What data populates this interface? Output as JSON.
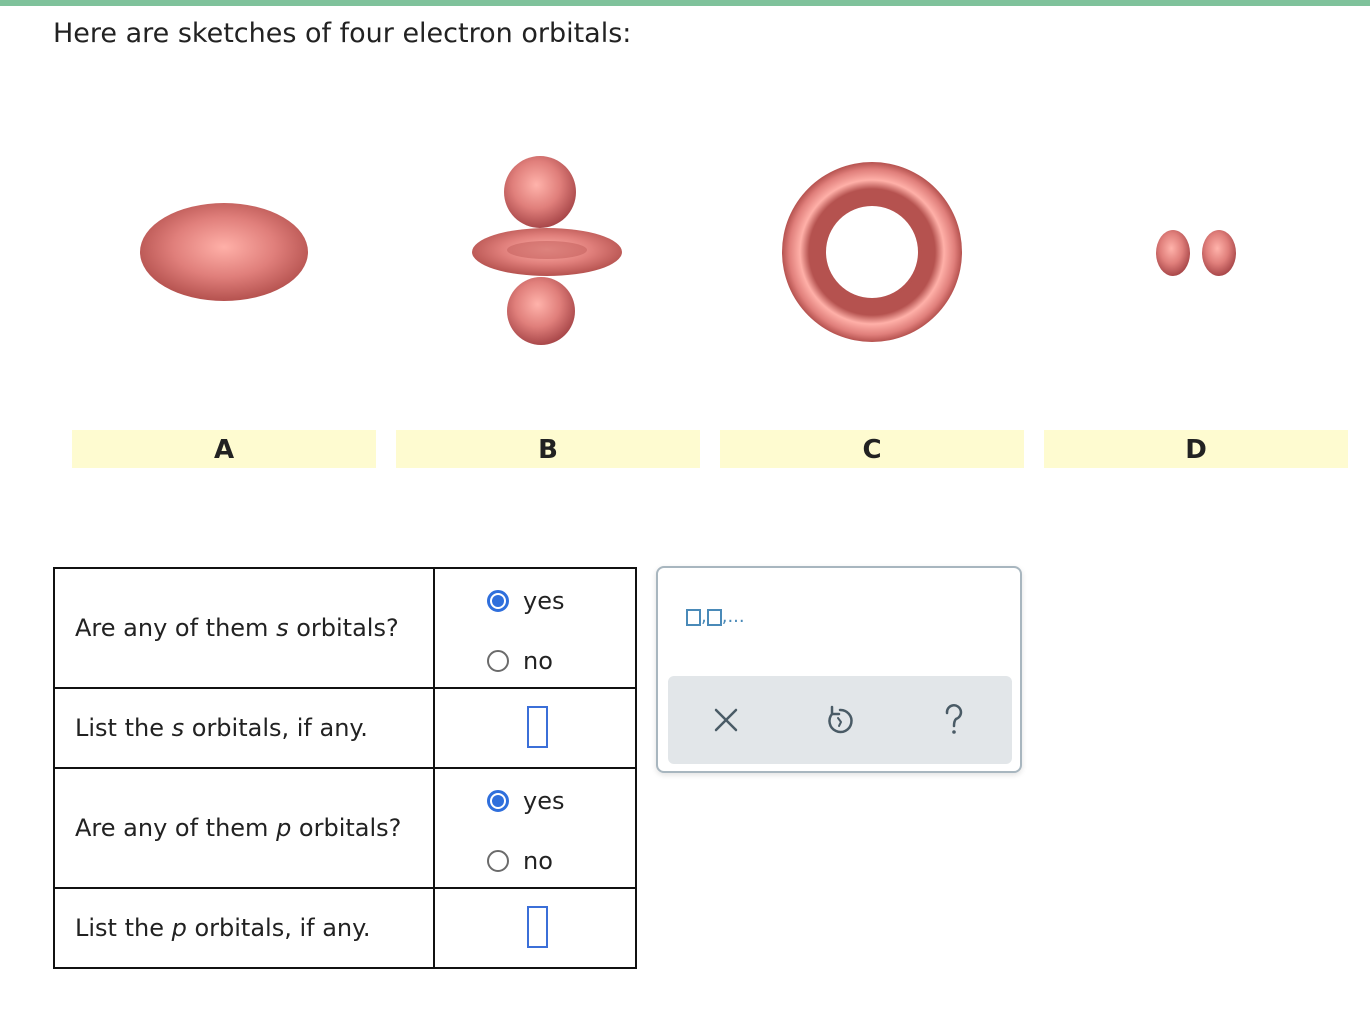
{
  "prompt": "Here are sketches of four electron orbitals:",
  "orbitals": [
    {
      "label": "A"
    },
    {
      "label": "B"
    },
    {
      "label": "C"
    },
    {
      "label": "D"
    }
  ],
  "colors": {
    "orbital": "#e07f7b",
    "label_bg": "#fefbd0",
    "radio_selected": "#2f6fdc",
    "input_border": "#3b6fd8",
    "accent_bar": "#7fc29b"
  },
  "questions": {
    "s_orbitals": {
      "pre": "Are any of them ",
      "var": "s",
      "post": " orbitals?",
      "options": [
        "yes",
        "no"
      ],
      "selected": "yes"
    },
    "s_list": {
      "pre": "List the ",
      "var": "s",
      "post": " orbitals, if any.",
      "value": ""
    },
    "p_orbitals": {
      "pre": "Are any of them ",
      "var": "p",
      "post": " orbitals?",
      "options": [
        "yes",
        "no"
      ],
      "selected": "yes"
    },
    "p_list": {
      "pre": "List the ",
      "var": "p",
      "post": " orbitals, if any.",
      "value": ""
    }
  },
  "panel": {
    "sequence_sep1": ",",
    "sequence_sep2": ",...",
    "tools": [
      "close-icon",
      "undo-icon",
      "help-icon"
    ]
  }
}
